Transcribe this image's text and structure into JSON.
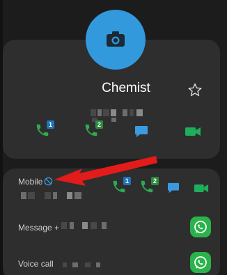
{
  "contact": {
    "name": "Chemist"
  },
  "icons": {
    "avatar": "camera-icon",
    "favorite": "star-outline-icon",
    "block": "blocked-icon",
    "call": "phone-icon",
    "message": "message-icon",
    "video": "video-icon",
    "whatsapp": "whatsapp-icon",
    "annotation": "red-arrow"
  },
  "header_actions": [
    {
      "type": "call",
      "sim": "1"
    },
    {
      "type": "call",
      "sim": "2"
    },
    {
      "type": "message"
    },
    {
      "type": "video"
    }
  ],
  "details": {
    "mobile": {
      "label": "Mobile",
      "actions": [
        {
          "type": "call",
          "sim": "1"
        },
        {
          "type": "call",
          "sim": "2"
        },
        {
          "type": "message"
        },
        {
          "type": "video"
        }
      ]
    },
    "whatsapp_message": {
      "label": "Message +"
    },
    "whatsapp_voice": {
      "label": "Voice call"
    }
  },
  "colors": {
    "background": "#1c1c1c",
    "card": "#2e2e2e",
    "avatar": "#3399dd",
    "call_green": "#2eaa52",
    "message_blue": "#3a9be0",
    "video_green": "#1fae5c",
    "sim1": "#1f73b7",
    "sim2": "#2e8b3e",
    "whatsapp": "#2bb34b",
    "arrow_red": "#e31b1b"
  }
}
